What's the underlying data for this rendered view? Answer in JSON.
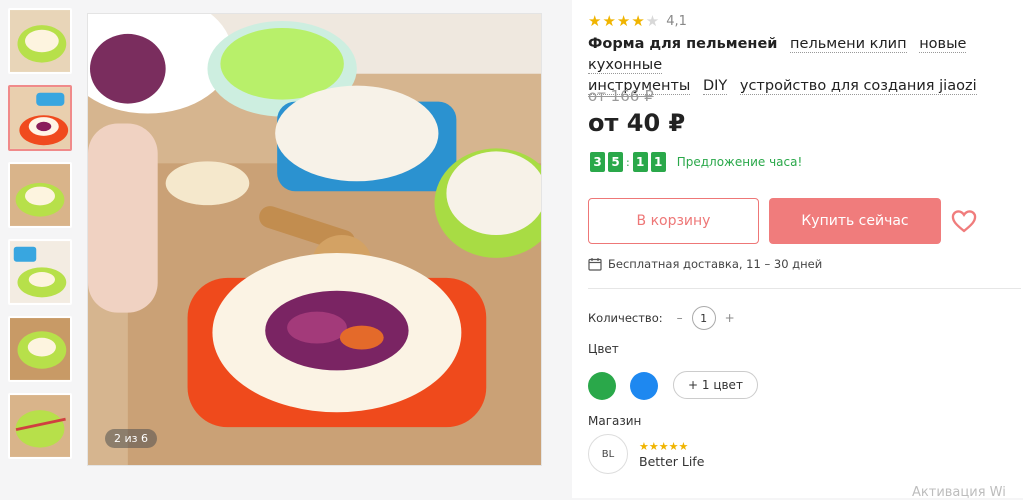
{
  "gallery": {
    "counter": "2 из 6",
    "thumb_count": 6,
    "active_thumb": 2
  },
  "product": {
    "rating_value": "4,1",
    "rating_stars": 4.1,
    "title_lead": "Форма для пельменей",
    "title_tags": [
      "пельмени клип",
      "новые кухонные",
      "инструменты",
      "DIY",
      "устройство для создания jiaozi"
    ],
    "old_price": "от 166 ₽",
    "price": "от 40 ₽"
  },
  "timer": {
    "digits": [
      "3",
      "5",
      "1",
      "1"
    ],
    "label": "Предложение часа!"
  },
  "actions": {
    "cart_label": "В корзину",
    "buy_label": "Купить сейчас"
  },
  "delivery": {
    "text": "Бесплатная доставка, 11 – 30 дней"
  },
  "quantity": {
    "label": "Количество:",
    "minus": "–",
    "value": "1",
    "plus": "+"
  },
  "colors": {
    "label": "Цвет",
    "swatches": [
      "#2aa84a",
      "#1e88f0"
    ],
    "more": "+ 1 цвет"
  },
  "shop": {
    "label": "Магазин",
    "avatar_text": "BL",
    "name": "Better Life",
    "stars": "★★★★★"
  },
  "theme": {
    "accent": "#f07c7c",
    "green": "#2aa84a",
    "star": "#f0b400"
  },
  "watermark": "Активация Wi"
}
